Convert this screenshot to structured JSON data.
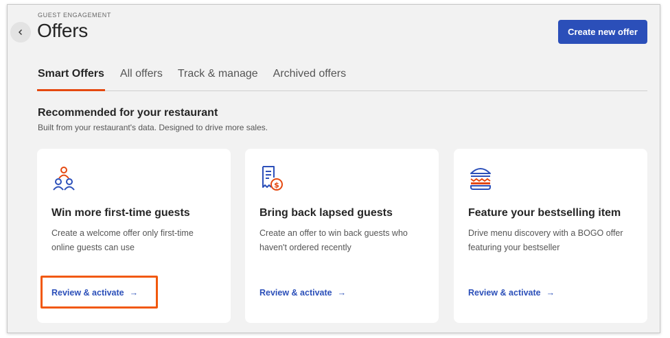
{
  "header": {
    "eyebrow": "GUEST ENGAGEMENT",
    "title": "Offers",
    "create_button_label": "Create new offer",
    "back_icon": "chevron-left-icon"
  },
  "tabs": [
    {
      "label": "Smart Offers",
      "active": true
    },
    {
      "label": "All offers",
      "active": false
    },
    {
      "label": "Track & manage",
      "active": false
    },
    {
      "label": "Archived offers",
      "active": false
    }
  ],
  "section": {
    "heading": "Recommended for your restaurant",
    "subheading": "Built from your restaurant's data. Designed to drive more sales."
  },
  "cards": [
    {
      "icon": "guests-group-icon",
      "title": "Win more first-time guests",
      "description": "Create a welcome offer only first-time online guests can use",
      "link_label": "Review & activate",
      "link_arrow": "→"
    },
    {
      "icon": "receipt-dollar-icon",
      "title": "Bring back lapsed guests",
      "description": "Create an offer to win back guests who haven't ordered recently",
      "link_label": "Review & activate",
      "link_arrow": "→"
    },
    {
      "icon": "burger-icon",
      "title": "Feature your bestselling item",
      "description": "Drive menu discovery with a BOGO offer featuring your bestseller",
      "link_label": "Review & activate",
      "link_arrow": "→"
    }
  ],
  "colors": {
    "accent_orange": "#e5480f",
    "primary_blue": "#2b4fb9",
    "background": "#f2f2f2",
    "highlight": "#f1580c"
  }
}
